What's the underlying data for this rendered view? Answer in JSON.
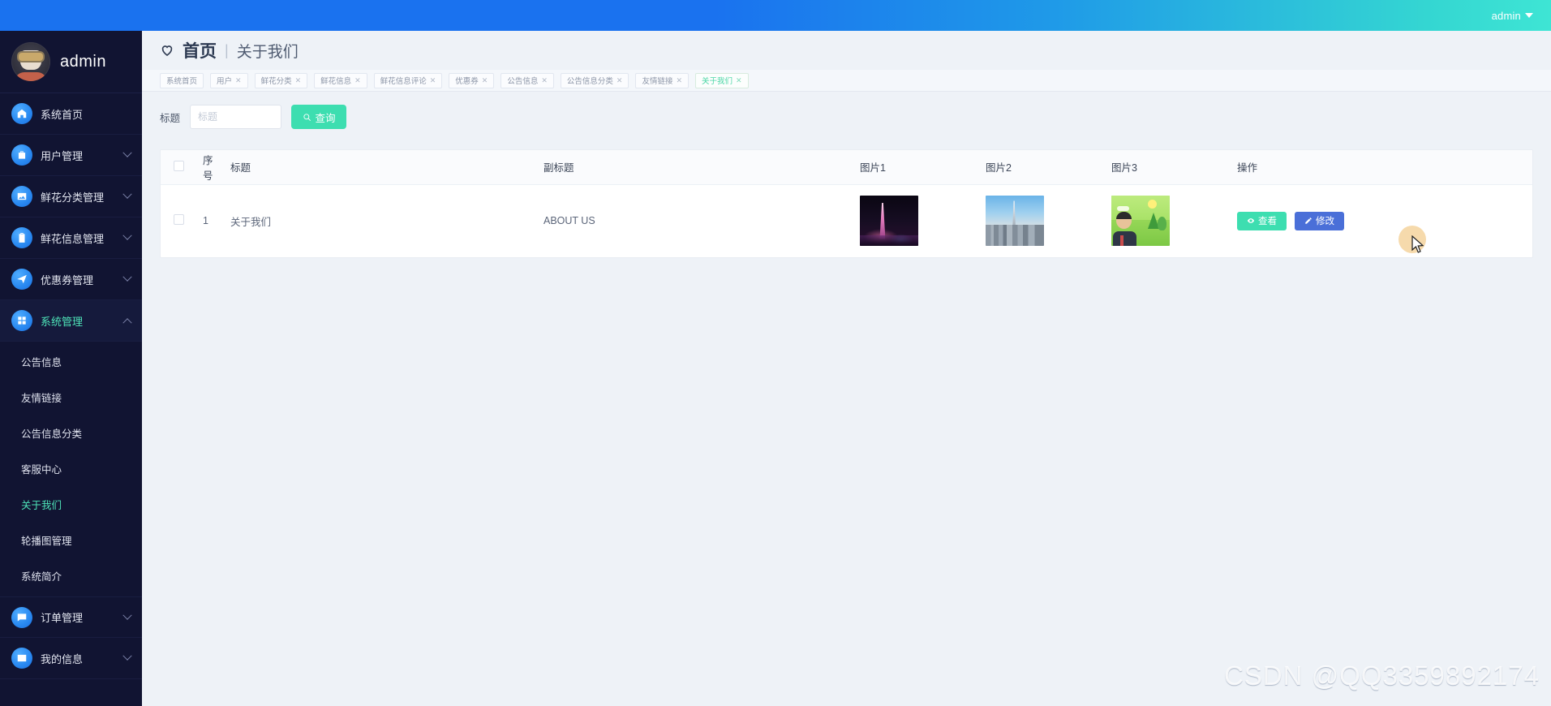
{
  "topbar": {
    "user_label": "admin",
    "caret_icon": "chevron-down-icon",
    "gradient_from": "#1a72ef",
    "gradient_to": "#3ee5d4"
  },
  "sidebar": {
    "profile": {
      "username": "admin",
      "avatar_icon": "user-avatar"
    },
    "bg_color": "#111432",
    "active_color": "#4ee3b8",
    "items": [
      {
        "label": "系统首页",
        "icon": "home-icon",
        "expandable": false,
        "active": false
      },
      {
        "label": "用户管理",
        "icon": "briefcase-icon",
        "expandable": true,
        "active": false
      },
      {
        "label": "鲜花分类管理",
        "icon": "image-icon",
        "expandable": true,
        "active": false
      },
      {
        "label": "鲜花信息管理",
        "icon": "clipboard-icon",
        "expandable": true,
        "active": false
      },
      {
        "label": "优惠券管理",
        "icon": "paper-plane-icon",
        "expandable": true,
        "active": false
      },
      {
        "label": "系统管理",
        "icon": "grid-icon",
        "expandable": true,
        "active": true,
        "expanded": true
      }
    ],
    "system_submenu": [
      {
        "label": "公告信息",
        "active": false
      },
      {
        "label": "友情链接",
        "active": false
      },
      {
        "label": "公告信息分类",
        "active": false
      },
      {
        "label": "客服中心",
        "active": false
      },
      {
        "label": "关于我们",
        "active": true
      },
      {
        "label": "轮播图管理",
        "active": false
      },
      {
        "label": "系统简介",
        "active": false
      }
    ],
    "items_bottom": [
      {
        "label": "订单管理",
        "icon": "chat-icon",
        "expandable": true,
        "active": false
      },
      {
        "label": "我的信息",
        "icon": "card-icon",
        "expandable": true,
        "active": false
      }
    ]
  },
  "breadcrumb": {
    "heart_icon": "heart-icon",
    "home": "首页",
    "separator": "|",
    "current": "关于我们"
  },
  "tabs": [
    {
      "label": "系统首页",
      "closable": false,
      "active": false
    },
    {
      "label": "用户",
      "closable": true,
      "active": false
    },
    {
      "label": "鲜花分类",
      "closable": true,
      "active": false
    },
    {
      "label": "鲜花信息",
      "closable": true,
      "active": false
    },
    {
      "label": "鲜花信息评论",
      "closable": true,
      "active": false
    },
    {
      "label": "优惠券",
      "closable": true,
      "active": false
    },
    {
      "label": "公告信息",
      "closable": true,
      "active": false
    },
    {
      "label": "公告信息分类",
      "closable": true,
      "active": false
    },
    {
      "label": "友情链接",
      "closable": true,
      "active": false
    },
    {
      "label": "关于我们",
      "closable": true,
      "active": true
    }
  ],
  "search": {
    "label": "标题",
    "placeholder": "标题",
    "value": "",
    "button_label": "查询",
    "button_icon": "search-icon",
    "button_color": "#3ddeb0"
  },
  "table": {
    "columns": [
      "",
      "序号",
      "标题",
      "副标题",
      "图片1",
      "图片2",
      "图片3",
      "操作"
    ],
    "rows": [
      {
        "index": "1",
        "title": "关于我们",
        "subtitle": "ABOUT US",
        "image1": "night-cityscape-thumbnail",
        "image2": "daytime-skyline-thumbnail",
        "image3": "green-illustration-thumbnail",
        "actions": [
          {
            "label": "查看",
            "icon": "eye-icon",
            "color": "#3ddeb0"
          },
          {
            "label": "修改",
            "icon": "pencil-icon",
            "color": "#4a6fd8"
          }
        ]
      }
    ]
  },
  "watermark": {
    "text": "CSDN @QQ3359892174"
  }
}
